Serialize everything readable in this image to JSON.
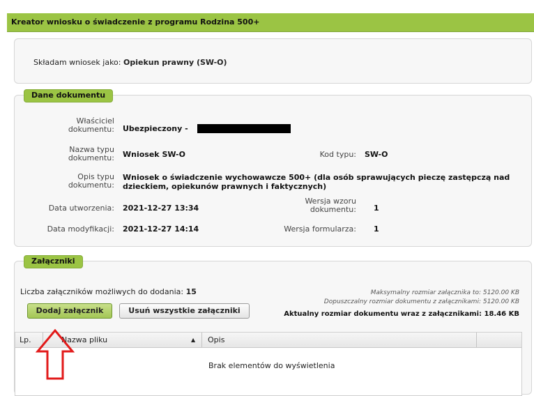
{
  "header": {
    "title": "Kreator wniosku o świadczenie z programu Rodzina 500+"
  },
  "submit_as": {
    "label": "Składam wniosek jako:",
    "value": "Opiekun prawny (SW-O)"
  },
  "document": {
    "legend": "Dane dokumentu",
    "owner_label": "Właściciel dokumentu:",
    "owner_value": "Ubezpieczony -",
    "type_name_label": "Nazwa typu dokumentu:",
    "type_name_value": "Wniosek SW-O",
    "type_code_label": "Kod typu:",
    "type_code_value": "SW-O",
    "desc_label": "Opis typu dokumentu:",
    "desc_value": "Wniosek o świadczenie wychowawcze 500+ (dla osób sprawujących pieczę zastępczą nad dzieckiem, opiekunów prawnych i faktycznych)",
    "created_label": "Data utworzenia:",
    "created_value": "2021-12-27 13:34",
    "template_ver_label": "Wersja wzoru dokumentu:",
    "template_ver_value": "1",
    "modified_label": "Data modyfikacji:",
    "modified_value": "2021-12-27 14:14",
    "form_ver_label": "Wersja formularza:",
    "form_ver_value": "1"
  },
  "attachments": {
    "legend": "Załączniki",
    "count_label": "Liczba załączników możliwych do dodania:",
    "count_value": "15",
    "max_size": "Maksymalny rozmiar załącznika to: 5120.00 KB",
    "allowed_size": "Dopuszczalny rozmiar dokumentu z załącznikami: 5120.00 KB",
    "current_size": "Aktualny rozmiar dokumentu wraz z załącznikami: 18.46 KB",
    "add_button": "Dodaj załącznik",
    "remove_all_button": "Usuń wszystkie załączniki",
    "table": {
      "col_no": "Lp.",
      "col_file": "Nazwa pliku",
      "col_desc": "Opis",
      "sort_indicator": "▲",
      "empty_message": "Brak elementów do wyświetlenia"
    }
  },
  "colors": {
    "accent": "#9bc444",
    "annotation_arrow": "#e21a1a"
  }
}
